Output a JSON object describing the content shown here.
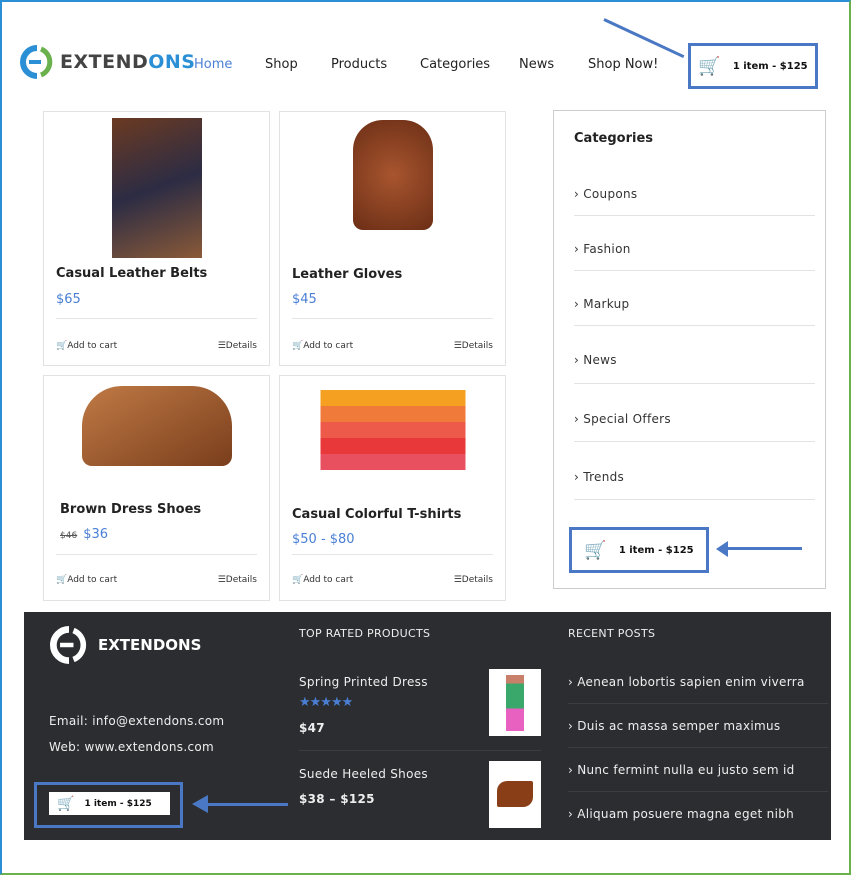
{
  "header": {
    "logo_text": "EXTEND",
    "logo_text_accent": "ONS",
    "nav": [
      "Home",
      "Shop",
      "Products",
      "Categories",
      "News",
      "Shop Now!"
    ],
    "active": "Home",
    "cart": "1 item - $125"
  },
  "products": [
    {
      "name": "Casual Leather Belts",
      "price": "$65",
      "old_price": "",
      "add": "Add to cart",
      "details": "Details"
    },
    {
      "name": "Leather Gloves",
      "price": "$45",
      "old_price": "",
      "add": "Add to cart",
      "details": "Details"
    },
    {
      "name": "Brown Dress Shoes",
      "price": "$36",
      "old_price": "$46",
      "add": "Add to cart",
      "details": "Details"
    },
    {
      "name": "Casual Colorful T-shirts",
      "price": "$50 - $80",
      "old_price": "",
      "add": "Add to cart",
      "details": "Details"
    }
  ],
  "sidebar": {
    "title": "Categories",
    "items": [
      "Coupons",
      "Fashion",
      "Markup",
      "News",
      "Special Offers",
      "Trends"
    ],
    "cart": "1 item - $125"
  },
  "footer": {
    "logo_text": "EXTENDONS",
    "email": "Email: info@extendons.com",
    "web": "Web: www.extendons.com",
    "cart": "1 item - $125",
    "top_title": "TOP RATED PRODUCTS",
    "top": [
      {
        "name": "Spring Printed Dress",
        "rating": 5,
        "price": "$47"
      },
      {
        "name": "Suede Heeled Shoes",
        "price": "$38 – $125"
      }
    ],
    "posts_title": "RECENT POSTS",
    "posts": [
      "Aenean lobortis sapien enim viverra",
      "Duis ac massa semper maximus",
      "Nunc fermint nulla eu justo sem id",
      "Aliquam posuere magna eget nibh"
    ]
  },
  "colors": {
    "accent": "#4a7fd4",
    "highlight_box": "#4a78c4",
    "footer_bg": "#2b2d31"
  }
}
